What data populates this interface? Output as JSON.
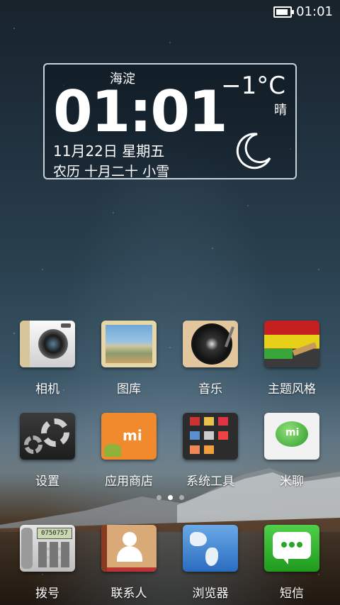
{
  "status_bar": {
    "time": "01:01"
  },
  "widget": {
    "city": "海淀",
    "time": "01:01",
    "date": "11月22日  星期五",
    "lunar": "农历 十月二十 小雪",
    "temperature": "−1°C",
    "condition": "晴"
  },
  "apps": [
    {
      "label": "相机"
    },
    {
      "label": "图库"
    },
    {
      "label": "音乐"
    },
    {
      "label": "主题风格"
    },
    {
      "label": "设置"
    },
    {
      "label": "应用商店"
    },
    {
      "label": "系统工具"
    },
    {
      "label": "米聊"
    }
  ],
  "dock": [
    {
      "label": "拨号",
      "display": "0750757"
    },
    {
      "label": "联系人"
    },
    {
      "label": "浏览器"
    },
    {
      "label": "短信"
    }
  ]
}
